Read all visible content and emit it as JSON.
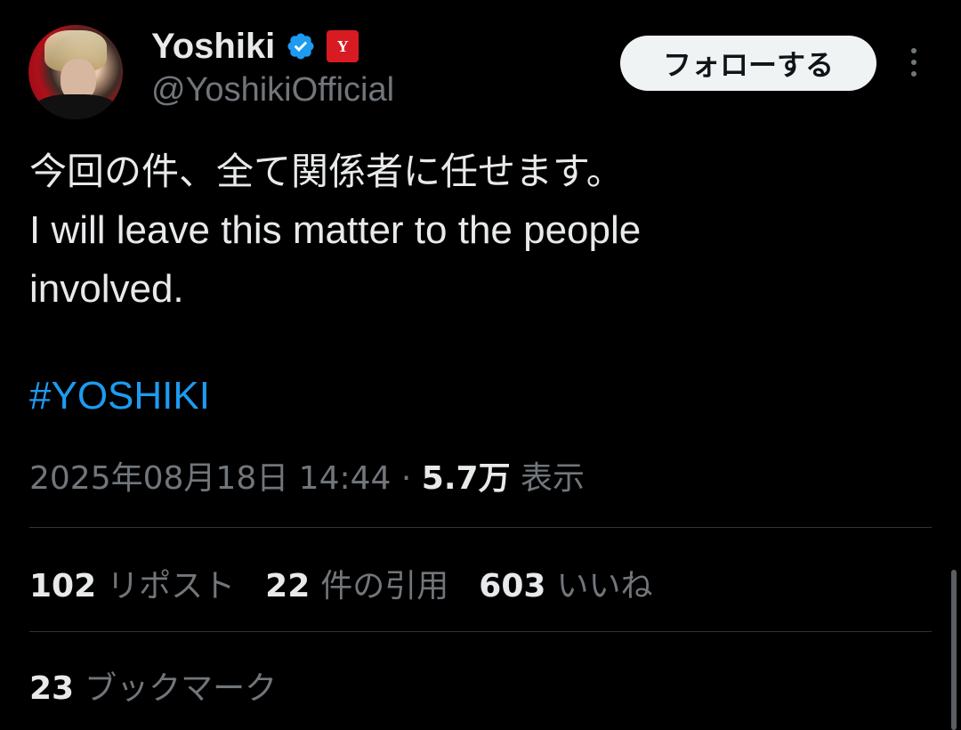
{
  "author": {
    "display_name": "Yoshiki",
    "handle": "@YoshikiOfficial",
    "affiliate_badge_text": "Y",
    "verified_icon": "verified-badge-icon",
    "accent_color": "#1d9bf0",
    "affiliate_color": "#d81a22"
  },
  "header": {
    "follow_label": "フォローする",
    "more_icon": "more-vertical-icon"
  },
  "tweet": {
    "lines": [
      "今回の件、全て関係者に任せます。",
      "I will leave this matter to the people",
      "involved."
    ],
    "hashtag": "#YOSHIKI"
  },
  "meta": {
    "timestamp": "2025年08月18日 14:44",
    "separator": "·",
    "views_count": "5.7万",
    "views_label": "表示"
  },
  "stats": {
    "reposts": {
      "count": "102",
      "label": "リポスト"
    },
    "quotes": {
      "count": "22",
      "label": "件の引用"
    },
    "likes": {
      "count": "603",
      "label": "いいね"
    },
    "bookmarks": {
      "count": "23",
      "label": "ブックマーク"
    }
  },
  "colors": {
    "background": "#000000",
    "primary_text": "#e7e9ea",
    "secondary_text": "#71767b",
    "divider": "#2f3336"
  }
}
